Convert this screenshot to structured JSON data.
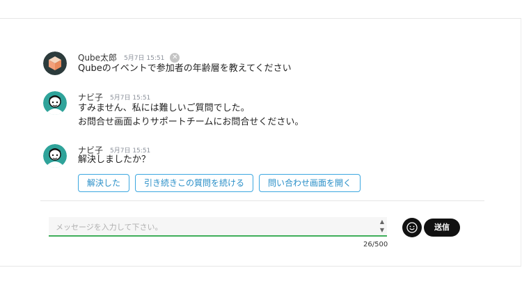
{
  "messages": [
    {
      "name": "Qube太郎",
      "time": "5月7日 15:51",
      "lines": [
        "Qubeのイベントで参加者の年齢層を教えてください"
      ]
    },
    {
      "name": "ナビ子",
      "time": "5月7日 15:51",
      "lines": [
        "すみません、私には難しいご質問でした。",
        "お問合せ画面よりサポートチームにお問合せください。"
      ]
    },
    {
      "name": "ナビ子",
      "time": "5月7日 15:51",
      "lines": [
        "解決しましたか？"
      ]
    }
  ],
  "actions": [
    "解決した",
    "引き続きこの質問を続ける",
    "問い合わせ画面を開く"
  ],
  "composer": {
    "placeholder": "メッセージを入力して下さい。",
    "counter": "26/500",
    "send_label": "送信"
  },
  "icons": {
    "close": "close-icon",
    "emoji": "emoji-icon",
    "spinner_up": "caret-up-icon",
    "spinner_down": "caret-down-icon"
  },
  "colors": {
    "accent_blue": "#3ba7e0",
    "input_underline": "#3fae5a",
    "send_bg": "#111111"
  }
}
